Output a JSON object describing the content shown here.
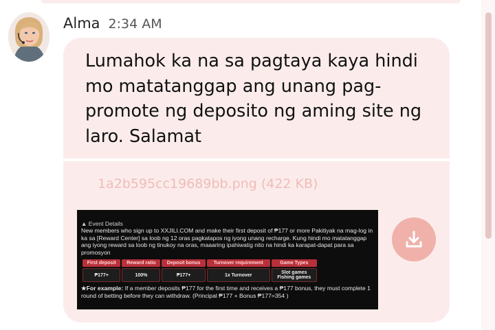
{
  "message": {
    "author": "Alma",
    "time": "2:34 AM",
    "text": "Lumahok ka na sa pagtaya kaya hindi mo matatanggap ang unang pag-promote ng deposito ng aming site ng laro. Salamat"
  },
  "attachment": {
    "file_name": "1a2b595cc19689bb.png",
    "file_size": "(422 KB)",
    "download_icon": "download-icon",
    "preview": {
      "heading": "▲ Event Details",
      "description": "New members who sign up to XXJILI.COM and make their first deposit of ₱177 or more Pakitiyak na mag-log in ka sa [Reward Center] sa loob ng 12 oras pagkatapos ng iyong unang recharge. Kung hindi mo matatanggap ang iyong reward sa loob ng tinukoy na oras, maaaring ipahiwatig nito na hindi ka karapat-dapat para sa promosyon",
      "table_headers": [
        "First deposit",
        "Reward ratio",
        "Deposit bonus",
        "Turnover requirement",
        "Game Types"
      ],
      "table_row": [
        "₱177+",
        "100%",
        "₱177+",
        "1x Turnover",
        "Slot games\nFishing games"
      ],
      "example_label": "★For example:",
      "example_text": " If a member deposits ₱177 for the first time and receives a ₱177 bonus, they must complete 1 round of betting before they can withdraw.  (Principal ₱177 + Bonus ₱177=354 )"
    }
  },
  "colors": {
    "bubble_bg": "#fbeceb",
    "file_name": "#efbcb8",
    "download_button": "#f0b1ab",
    "table_header": "#b8303a"
  }
}
